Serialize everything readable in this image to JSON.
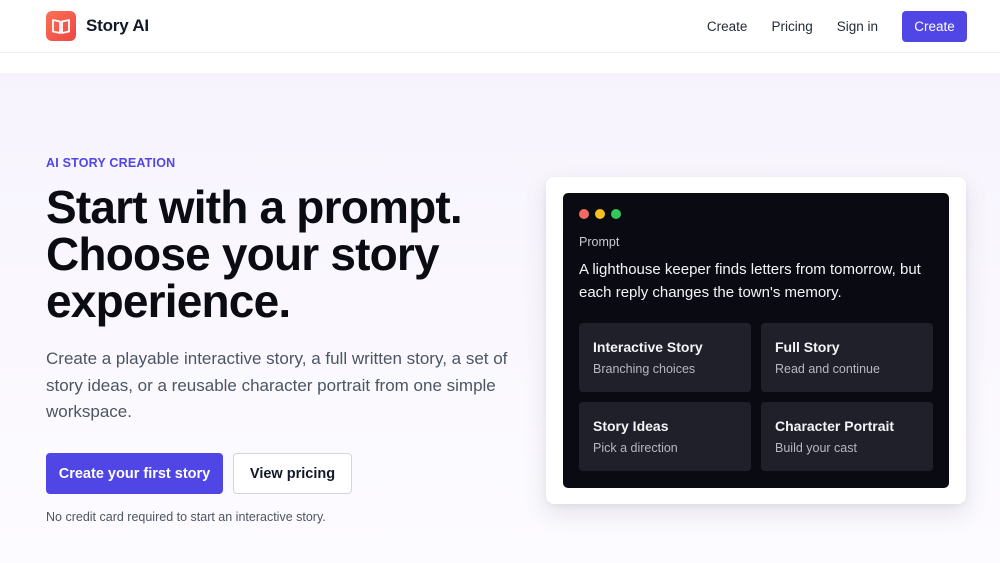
{
  "header": {
    "brand": "Story AI",
    "logo_icon": "open-book-icon",
    "nav": {
      "create_label": "Create",
      "pricing_label": "Pricing",
      "signin_label": "Sign in",
      "create_button_label": "Create"
    }
  },
  "hero": {
    "eyebrow": "AI STORY CREATION",
    "headline": "Start with a prompt. Choose your story experience.",
    "subcopy": "Create a playable interactive story, a full written story, a set of story ideas, or a reusable character portrait from one simple workspace.",
    "primary_cta": "Create your first story",
    "secondary_cta": "View pricing",
    "note": "No credit card required to start an interactive story."
  },
  "preview": {
    "prompt_label": "Prompt",
    "prompt_text": "A lighthouse keeper finds letters from tomorrow, but each reply changes the town's memory.",
    "options": [
      {
        "title": "Interactive Story",
        "subtitle": "Branching choices"
      },
      {
        "title": "Full Story",
        "subtitle": "Read and continue"
      },
      {
        "title": "Story Ideas",
        "subtitle": "Pick a direction"
      },
      {
        "title": "Character Portrait",
        "subtitle": "Build your cast"
      }
    ]
  },
  "colors": {
    "accent": "#4f46e5",
    "logo_gradient_start": "#f97355",
    "logo_gradient_end": "#ef4444",
    "terminal_bg": "#0a0b12",
    "tile_bg": "#1f2029"
  }
}
